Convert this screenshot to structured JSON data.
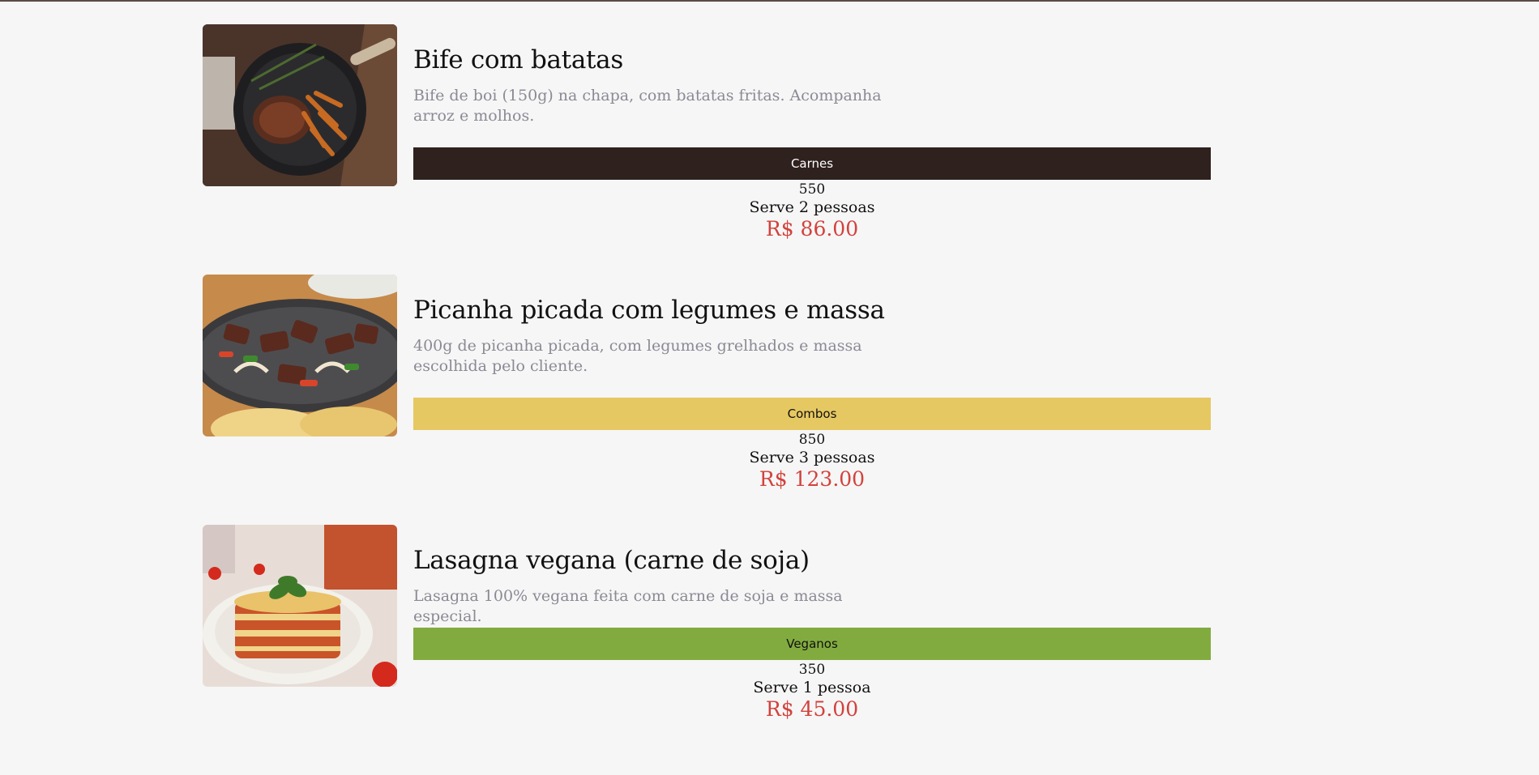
{
  "dishes": [
    {
      "title": "Bife com batatas",
      "description": "Bife de boi (150g) na chapa, com batatas fritas. Acompanha arroz e molhos.",
      "category": "Carnes",
      "category_color": "#2e211e",
      "category_text_color": "#ffffff",
      "weight": "550",
      "serves": "Serve 2 pessoas",
      "price": "R$ 86.00",
      "image_icon": "steak-photo"
    },
    {
      "title": "Picanha picada com legumes e massa",
      "description": "400g de picanha picada, com legumes grelhados e massa escolhida pelo cliente.",
      "category": "Combos",
      "category_color": "#e6c862",
      "category_text_color": "#111111",
      "weight": "850",
      "serves": "Serve 3 pessoas",
      "price": "R$ 123.00",
      "image_icon": "fajita-photo"
    },
    {
      "title": "Lasagna vegana (carne de soja)",
      "description": "Lasagna 100% vegana feita com carne de soja e massa especial.",
      "category": "Veganos",
      "category_color": "#82ab3f",
      "category_text_color": "#111111",
      "weight": "350",
      "serves": "Serve 1 pessoa",
      "price": "R$ 45.00",
      "image_icon": "lasagna-photo"
    }
  ],
  "colors": {
    "background": "#f6f6f6",
    "price": "#d2423c",
    "description": "#8a8a95"
  }
}
